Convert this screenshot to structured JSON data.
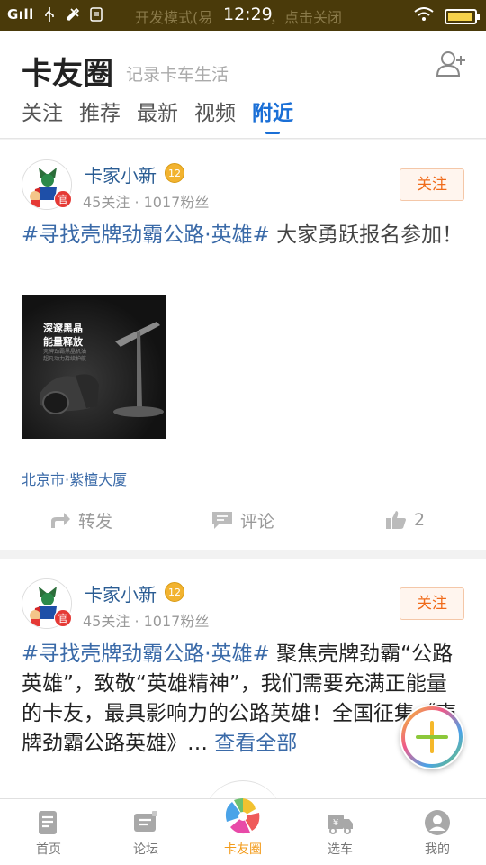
{
  "status_bar": {
    "signal": "Gıll",
    "dev_mode": "开发模式(易",
    "dev_tail": "，点击关闭",
    "time": "12:29"
  },
  "header": {
    "title": "卡友圈",
    "subtitle": "记录卡车生活",
    "tabs": [
      {
        "label": "关注"
      },
      {
        "label": "推荐"
      },
      {
        "label": "最新"
      },
      {
        "label": "视频"
      },
      {
        "label": "附近",
        "active": true
      }
    ]
  },
  "posts": [
    {
      "username": "卡家小新",
      "vip_level": "12",
      "official_badge": "官",
      "stats": "45关注 · 1017粉丝",
      "follow_label": "关注",
      "topic": "#寻找壳牌劲霸公路·英雄#",
      "text": " 大家勇跃报名参加！",
      "image_text_1": "深邃黑晶",
      "image_text_2": "能量释放",
      "image_small_1": "壳牌劲霸黑晶机油",
      "image_small_2": "超凡动力持续护航",
      "location": "北京市·紫檀大厦",
      "repost_label": "转发",
      "comment_label": "评论",
      "like_count": "2"
    },
    {
      "username": "卡家小新",
      "vip_level": "12",
      "official_badge": "官",
      "stats": "45关注 · 1017粉丝",
      "follow_label": "关注",
      "topic": "#寻找壳牌劲霸公路·英雄#",
      "text": " 聚焦壳牌劲霸“公路英雄”，致敬“英雄精神”，我们需要充满正能量的卡友，最具影响力的公路英雄！全国征集《壳牌劲霸公路英雄》…",
      "more_label": " 查看全部"
    }
  ],
  "bottom_nav": [
    {
      "label": "首页",
      "icon": "home-doc-icon"
    },
    {
      "label": "论坛",
      "icon": "forum-icon"
    },
    {
      "label": "卡友圈",
      "icon": "pinwheel-icon",
      "active": true
    },
    {
      "label": "选车",
      "icon": "truck-icon"
    },
    {
      "label": "我的",
      "icon": "profile-icon"
    }
  ],
  "colors": {
    "accent_blue": "#1a6fd6",
    "link_blue": "#3a6aa8",
    "follow_orange": "#f06b1a",
    "nav_active": "#f39b1a"
  }
}
